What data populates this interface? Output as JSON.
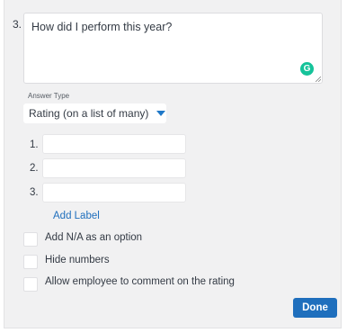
{
  "question": {
    "number": "3.",
    "text": "How did I perform this year?",
    "grammarly_icon": "G"
  },
  "answer_type": {
    "label": "Answer Type",
    "selected": "Rating (on a list of many)"
  },
  "options": [
    {
      "number": "1.",
      "value": ""
    },
    {
      "number": "2.",
      "value": ""
    },
    {
      "number": "3.",
      "value": ""
    }
  ],
  "add_label": "Add Label",
  "checkboxes": [
    {
      "label": "Add N/A as an option",
      "checked": false
    },
    {
      "label": "Hide numbers",
      "checked": false
    },
    {
      "label": "Allow employee to comment on the rating",
      "checked": false
    }
  ],
  "done_label": "Done",
  "colors": {
    "accent": "#1f6fbd",
    "grammarly": "#15c39a",
    "panel_bg": "#f1f1f2"
  }
}
